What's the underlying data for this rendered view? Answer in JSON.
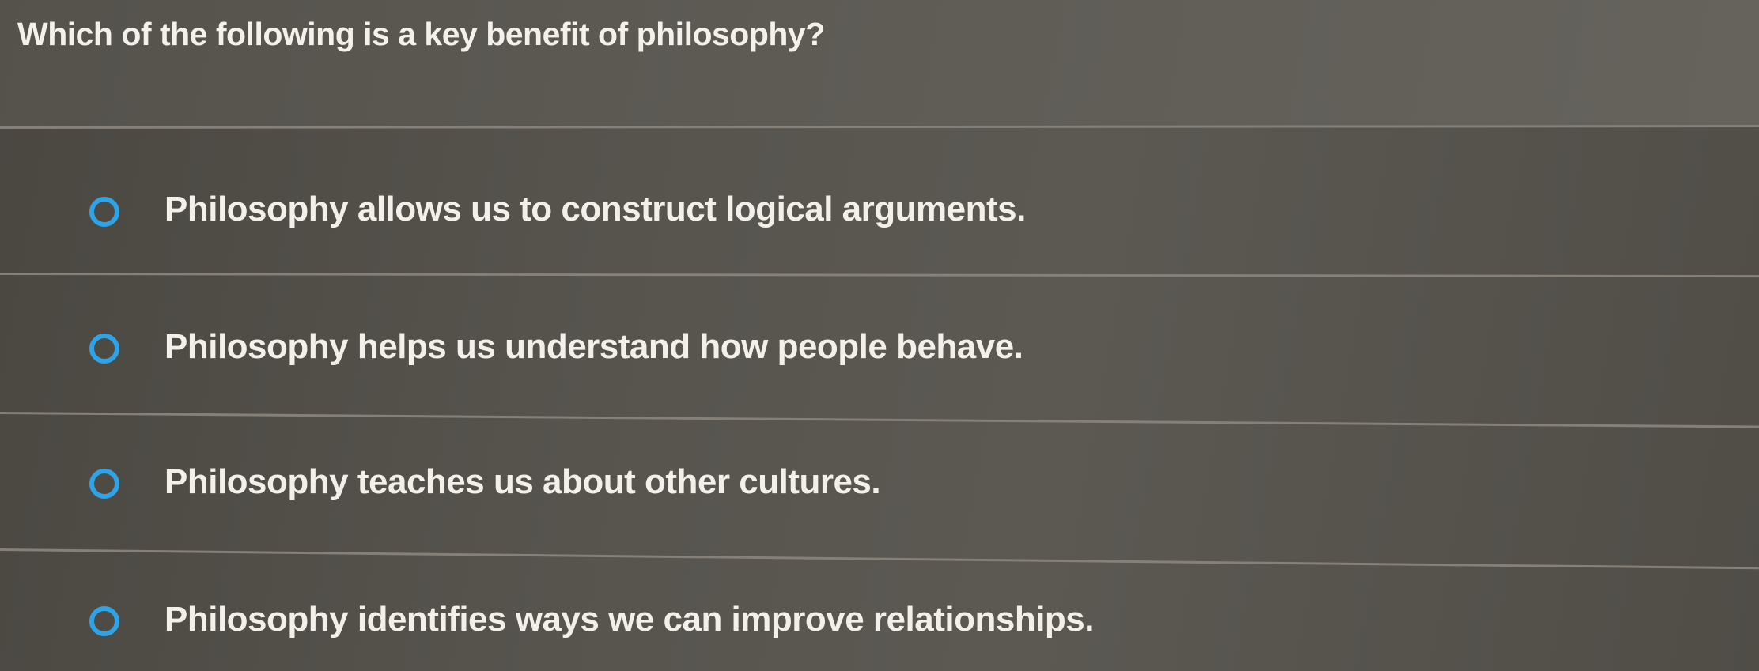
{
  "question": {
    "text": "Which of the following is a key benefit of philosophy?"
  },
  "options": [
    {
      "label": "Philosophy allows us to construct logical arguments.",
      "selected": false
    },
    {
      "label": "Philosophy helps us understand how people behave.",
      "selected": false
    },
    {
      "label": "Philosophy teaches us about other cultures.",
      "selected": false
    },
    {
      "label": "Philosophy identifies ways we can improve relationships.",
      "selected": false
    }
  ],
  "colors": {
    "radio_accent": "#2ea3e8",
    "text": "#f3f0e9",
    "background": "#57544e"
  }
}
